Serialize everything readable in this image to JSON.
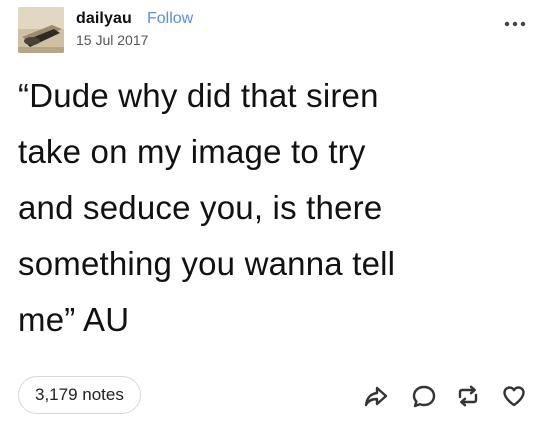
{
  "post": {
    "author": "dailyau",
    "follow_label": "Follow",
    "date": "15 Jul 2017",
    "text": "“Dude why did that siren\ntake on my image to try\nand seduce you, is there\nsomething you wanna tell\nme” AU",
    "notes_label": "3,179 notes"
  },
  "icons": {
    "more": "more-options-icon",
    "share": "share-icon",
    "reply": "reply-icon",
    "reblog": "reblog-icon",
    "like": "heart-icon"
  },
  "colors": {
    "follow": "#5b8fd6",
    "text": "#111111",
    "muted": "#555555",
    "notes_border": "#d7d7d7"
  }
}
